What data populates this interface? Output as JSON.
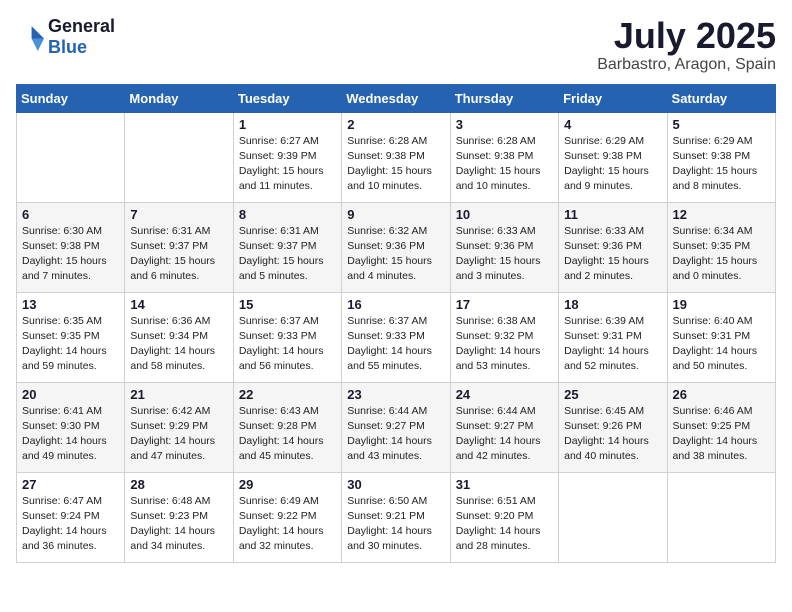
{
  "header": {
    "logo_general": "General",
    "logo_blue": "Blue",
    "month_year": "July 2025",
    "location": "Barbastro, Aragon, Spain"
  },
  "days_of_week": [
    "Sunday",
    "Monday",
    "Tuesday",
    "Wednesday",
    "Thursday",
    "Friday",
    "Saturday"
  ],
  "weeks": [
    [
      {
        "day": "",
        "detail": ""
      },
      {
        "day": "",
        "detail": ""
      },
      {
        "day": "1",
        "detail": "Sunrise: 6:27 AM\nSunset: 9:39 PM\nDaylight: 15 hours\nand 11 minutes."
      },
      {
        "day": "2",
        "detail": "Sunrise: 6:28 AM\nSunset: 9:38 PM\nDaylight: 15 hours\nand 10 minutes."
      },
      {
        "day": "3",
        "detail": "Sunrise: 6:28 AM\nSunset: 9:38 PM\nDaylight: 15 hours\nand 10 minutes."
      },
      {
        "day": "4",
        "detail": "Sunrise: 6:29 AM\nSunset: 9:38 PM\nDaylight: 15 hours\nand 9 minutes."
      },
      {
        "day": "5",
        "detail": "Sunrise: 6:29 AM\nSunset: 9:38 PM\nDaylight: 15 hours\nand 8 minutes."
      }
    ],
    [
      {
        "day": "6",
        "detail": "Sunrise: 6:30 AM\nSunset: 9:38 PM\nDaylight: 15 hours\nand 7 minutes."
      },
      {
        "day": "7",
        "detail": "Sunrise: 6:31 AM\nSunset: 9:37 PM\nDaylight: 15 hours\nand 6 minutes."
      },
      {
        "day": "8",
        "detail": "Sunrise: 6:31 AM\nSunset: 9:37 PM\nDaylight: 15 hours\nand 5 minutes."
      },
      {
        "day": "9",
        "detail": "Sunrise: 6:32 AM\nSunset: 9:36 PM\nDaylight: 15 hours\nand 4 minutes."
      },
      {
        "day": "10",
        "detail": "Sunrise: 6:33 AM\nSunset: 9:36 PM\nDaylight: 15 hours\nand 3 minutes."
      },
      {
        "day": "11",
        "detail": "Sunrise: 6:33 AM\nSunset: 9:36 PM\nDaylight: 15 hours\nand 2 minutes."
      },
      {
        "day": "12",
        "detail": "Sunrise: 6:34 AM\nSunset: 9:35 PM\nDaylight: 15 hours\nand 0 minutes."
      }
    ],
    [
      {
        "day": "13",
        "detail": "Sunrise: 6:35 AM\nSunset: 9:35 PM\nDaylight: 14 hours\nand 59 minutes."
      },
      {
        "day": "14",
        "detail": "Sunrise: 6:36 AM\nSunset: 9:34 PM\nDaylight: 14 hours\nand 58 minutes."
      },
      {
        "day": "15",
        "detail": "Sunrise: 6:37 AM\nSunset: 9:33 PM\nDaylight: 14 hours\nand 56 minutes."
      },
      {
        "day": "16",
        "detail": "Sunrise: 6:37 AM\nSunset: 9:33 PM\nDaylight: 14 hours\nand 55 minutes."
      },
      {
        "day": "17",
        "detail": "Sunrise: 6:38 AM\nSunset: 9:32 PM\nDaylight: 14 hours\nand 53 minutes."
      },
      {
        "day": "18",
        "detail": "Sunrise: 6:39 AM\nSunset: 9:31 PM\nDaylight: 14 hours\nand 52 minutes."
      },
      {
        "day": "19",
        "detail": "Sunrise: 6:40 AM\nSunset: 9:31 PM\nDaylight: 14 hours\nand 50 minutes."
      }
    ],
    [
      {
        "day": "20",
        "detail": "Sunrise: 6:41 AM\nSunset: 9:30 PM\nDaylight: 14 hours\nand 49 minutes."
      },
      {
        "day": "21",
        "detail": "Sunrise: 6:42 AM\nSunset: 9:29 PM\nDaylight: 14 hours\nand 47 minutes."
      },
      {
        "day": "22",
        "detail": "Sunrise: 6:43 AM\nSunset: 9:28 PM\nDaylight: 14 hours\nand 45 minutes."
      },
      {
        "day": "23",
        "detail": "Sunrise: 6:44 AM\nSunset: 9:27 PM\nDaylight: 14 hours\nand 43 minutes."
      },
      {
        "day": "24",
        "detail": "Sunrise: 6:44 AM\nSunset: 9:27 PM\nDaylight: 14 hours\nand 42 minutes."
      },
      {
        "day": "25",
        "detail": "Sunrise: 6:45 AM\nSunset: 9:26 PM\nDaylight: 14 hours\nand 40 minutes."
      },
      {
        "day": "26",
        "detail": "Sunrise: 6:46 AM\nSunset: 9:25 PM\nDaylight: 14 hours\nand 38 minutes."
      }
    ],
    [
      {
        "day": "27",
        "detail": "Sunrise: 6:47 AM\nSunset: 9:24 PM\nDaylight: 14 hours\nand 36 minutes."
      },
      {
        "day": "28",
        "detail": "Sunrise: 6:48 AM\nSunset: 9:23 PM\nDaylight: 14 hours\nand 34 minutes."
      },
      {
        "day": "29",
        "detail": "Sunrise: 6:49 AM\nSunset: 9:22 PM\nDaylight: 14 hours\nand 32 minutes."
      },
      {
        "day": "30",
        "detail": "Sunrise: 6:50 AM\nSunset: 9:21 PM\nDaylight: 14 hours\nand 30 minutes."
      },
      {
        "day": "31",
        "detail": "Sunrise: 6:51 AM\nSunset: 9:20 PM\nDaylight: 14 hours\nand 28 minutes."
      },
      {
        "day": "",
        "detail": ""
      },
      {
        "day": "",
        "detail": ""
      }
    ]
  ]
}
